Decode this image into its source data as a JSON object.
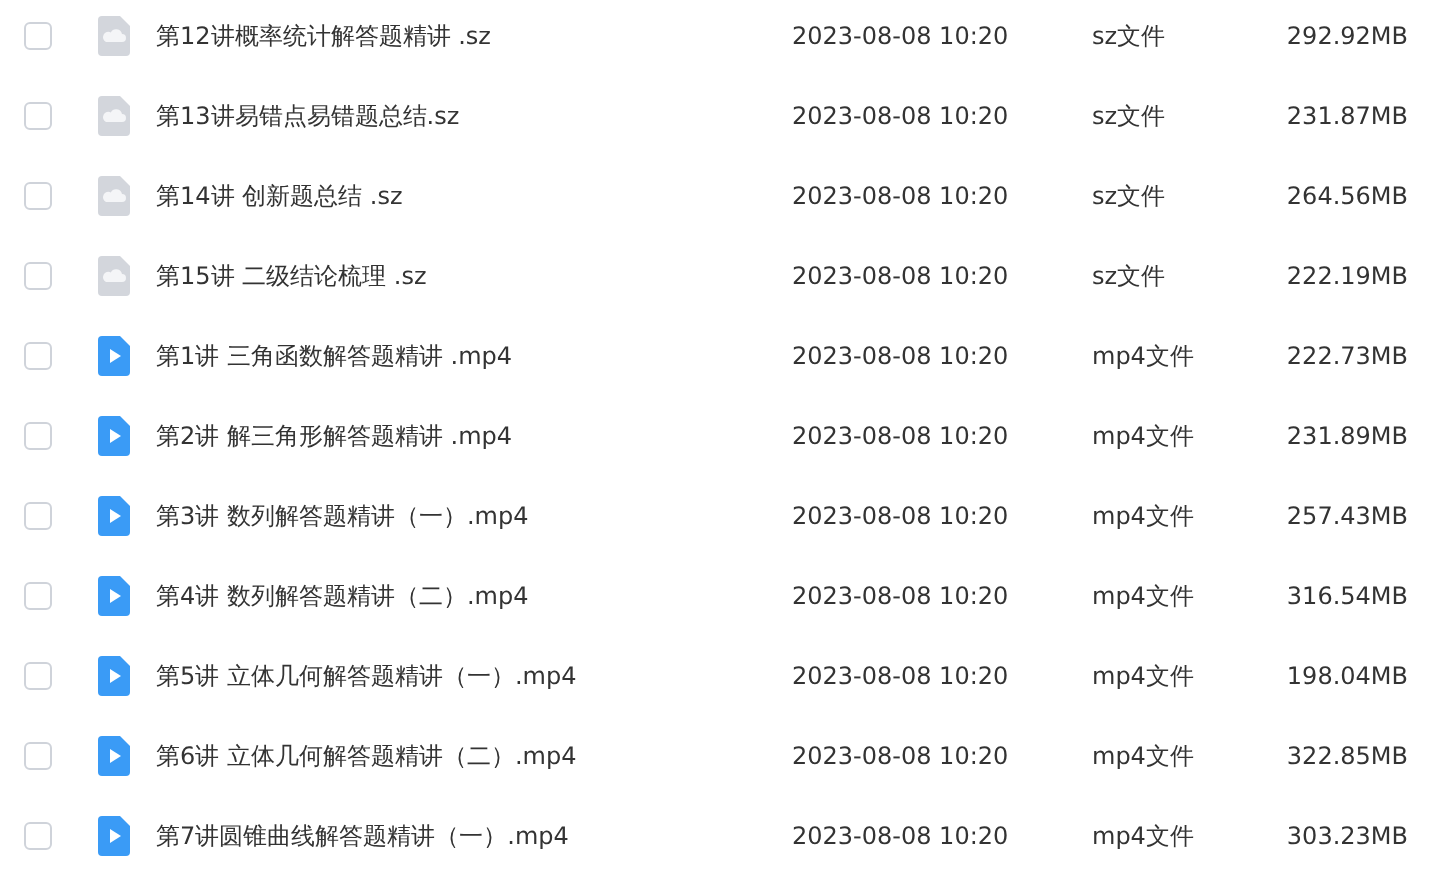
{
  "files": [
    {
      "kind": "archive",
      "checked": false,
      "name": "第12讲概率统计解答题精讲 .sz",
      "modified": "2023-08-08 10:20",
      "type": "sz文件",
      "size": "292.92MB"
    },
    {
      "kind": "archive",
      "checked": false,
      "name": "第13讲易错点易错题总结.sz",
      "modified": "2023-08-08 10:20",
      "type": "sz文件",
      "size": "231.87MB"
    },
    {
      "kind": "archive",
      "checked": false,
      "name": "第14讲 创新题总结 .sz",
      "modified": "2023-08-08 10:20",
      "type": "sz文件",
      "size": "264.56MB"
    },
    {
      "kind": "archive",
      "checked": false,
      "name": "第15讲 二级结论梳理 .sz",
      "modified": "2023-08-08 10:20",
      "type": "sz文件",
      "size": "222.19MB"
    },
    {
      "kind": "video",
      "checked": false,
      "name": "第1讲 三角函数解答题精讲 .mp4",
      "modified": "2023-08-08 10:20",
      "type": "mp4文件",
      "size": "222.73MB"
    },
    {
      "kind": "video",
      "checked": false,
      "name": "第2讲 解三角形解答题精讲 .mp4",
      "modified": "2023-08-08 10:20",
      "type": "mp4文件",
      "size": "231.89MB"
    },
    {
      "kind": "video",
      "checked": false,
      "name": "第3讲 数列解答题精讲（一）.mp4",
      "modified": "2023-08-08 10:20",
      "type": "mp4文件",
      "size": "257.43MB"
    },
    {
      "kind": "video",
      "checked": false,
      "name": "第4讲 数列解答题精讲（二）.mp4",
      "modified": "2023-08-08 10:20",
      "type": "mp4文件",
      "size": "316.54MB"
    },
    {
      "kind": "video",
      "checked": false,
      "name": "第5讲 立体几何解答题精讲（一）.mp4",
      "modified": "2023-08-08 10:20",
      "type": "mp4文件",
      "size": "198.04MB"
    },
    {
      "kind": "video",
      "checked": false,
      "name": "第6讲 立体几何解答题精讲（二）.mp4",
      "modified": "2023-08-08 10:20",
      "type": "mp4文件",
      "size": "322.85MB"
    },
    {
      "kind": "video",
      "checked": false,
      "name": "第7讲圆锥曲线解答题精讲（一）.mp4",
      "modified": "2023-08-08 10:20",
      "type": "mp4文件",
      "size": "303.23MB"
    }
  ]
}
